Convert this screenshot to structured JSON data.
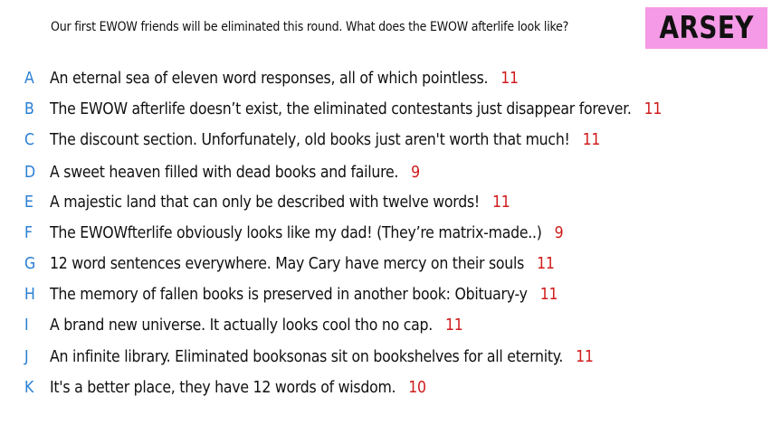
{
  "header": {
    "prompt": "Our first EWOW friends will be eliminated this round. What does the EWOW afterlife look like?",
    "badge": "ARSEY",
    "badge_color": "#f59ae6"
  },
  "colors": {
    "letter": "#2a7fd4",
    "score": "#d01c1c",
    "text": "#111111"
  },
  "responses": [
    {
      "letter": "A",
      "text": "An eternal sea of eleven word responses, all of which pointless.",
      "score": "11"
    },
    {
      "letter": "B",
      "text": "The EWOW afterlife doesn’t exist, the eliminated contestants just disappear forever.",
      "score": "11"
    },
    {
      "letter": "C",
      "text": "The discount section. Unforfunately, old books just aren't worth that much!",
      "score": "11"
    },
    {
      "letter": "D",
      "text": "A sweet heaven filled with dead books and failure.",
      "score": "9"
    },
    {
      "letter": "E",
      "text": "A majestic land that can only be described with twelve words!",
      "score": "11"
    },
    {
      "letter": "F",
      "text": "The EWOWfterlife obviously looks like my dad! (They’re matrix-made..)",
      "score": "9"
    },
    {
      "letter": "G",
      "text": "12 word sentences everywhere. May Cary have mercy on their souls",
      "score": "11"
    },
    {
      "letter": "H",
      "text": "The memory of fallen books is preserved in another book: Obituary-y",
      "score": "11"
    },
    {
      "letter": "I",
      "text": "A brand new universe. It actually looks cool tho no cap.",
      "score": "11"
    },
    {
      "letter": "J",
      "text": "An infinite library. Eliminated booksonas sit on bookshelves for all eternity.",
      "score": "11"
    },
    {
      "letter": "K",
      "text": "It's a better place, they have 12 words of wisdom.",
      "score": "10"
    }
  ]
}
